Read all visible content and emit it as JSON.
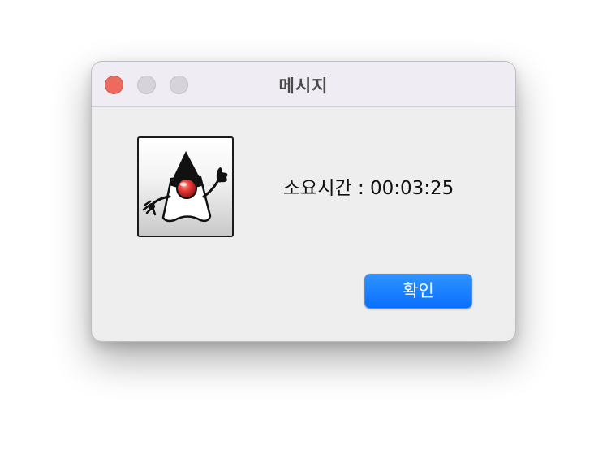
{
  "window": {
    "title": "메시지",
    "controls": {
      "close": "close-icon",
      "minimize": "minimize-icon",
      "maximize": "maximize-icon"
    }
  },
  "dialog": {
    "icon": "java-duke-icon",
    "message": "소요시간 : 00:03:25",
    "ok_label": "확인"
  },
  "colors": {
    "close": "#ec6a5e",
    "inactive_control": "#d6d3da",
    "titlebar": "#efecf3",
    "body": "#eeeeee",
    "button": "#0a6fff",
    "duke_nose": "#e53935"
  }
}
